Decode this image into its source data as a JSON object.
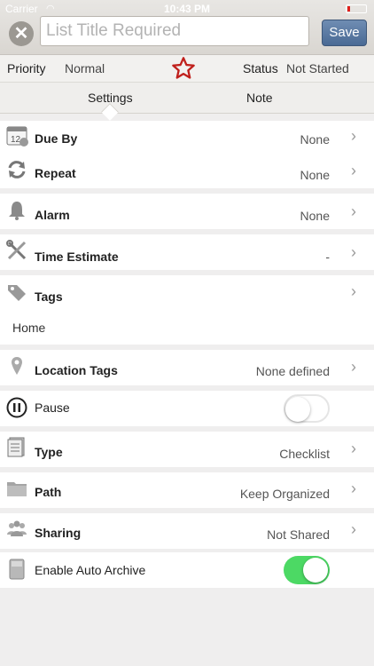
{
  "status_bar": {
    "carrier": "Carrier",
    "time": "10:43 PM"
  },
  "header": {
    "title_placeholder": "List Title Required",
    "save_label": "Save"
  },
  "priority_row": {
    "priority_label": "Priority",
    "priority_value": "Normal",
    "status_label": "Status",
    "status_value": "Not Started"
  },
  "tabs": {
    "settings": "Settings",
    "note": "Note",
    "selected": "settings"
  },
  "rows": {
    "due_by": {
      "label": "Due By",
      "value": "None"
    },
    "repeat": {
      "label": "Repeat",
      "value": "None"
    },
    "alarm": {
      "label": "Alarm",
      "value": "None"
    },
    "time_estimate": {
      "label": "Time Estimate",
      "value": "-"
    },
    "tags": {
      "label": "Tags",
      "value": "Home"
    },
    "location_tags": {
      "label": "Location Tags",
      "value": "None defined"
    },
    "pause": {
      "label": "Pause",
      "enabled": false
    },
    "type": {
      "label": "Type",
      "value": "Checklist"
    },
    "path": {
      "label": "Path",
      "value": "Keep Organized"
    },
    "sharing": {
      "label": "Sharing",
      "value": "Not Shared"
    },
    "auto_archive": {
      "label": "Enable Auto Archive",
      "enabled": true
    }
  },
  "colors": {
    "save_button": "#4a6a94",
    "star": "#c0201c",
    "toggle_on": "#4cd964"
  }
}
